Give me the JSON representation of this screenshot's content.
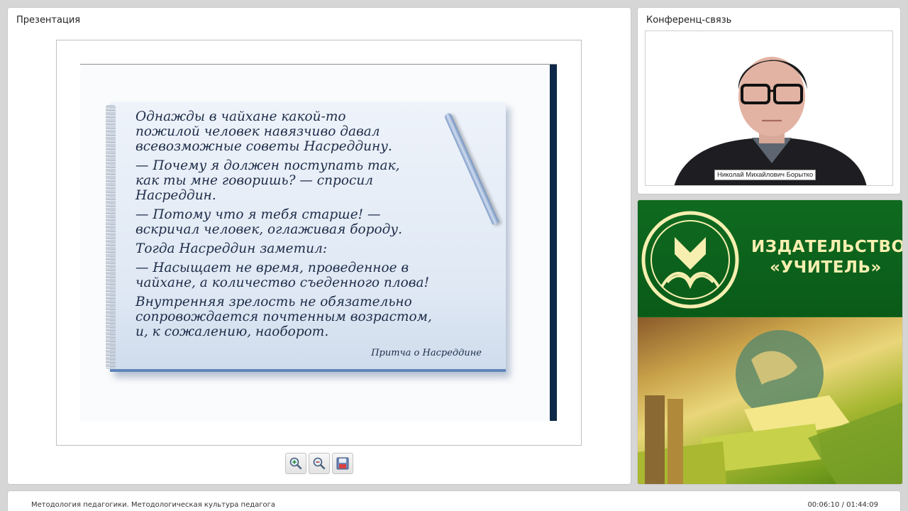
{
  "presentation": {
    "title": "Презентация",
    "slide": {
      "quote_lines": [
        "Однажды в чайхане какой-то",
        "пожилой человек навязчиво давал",
        "всевозможные советы Насреддину.",
        "— Почему я должен поступать так,",
        "как ты мне говоришь? — спросил",
        "Насреддин.",
        "— Потому что я тебя старше! —",
        "вскричал человек, оглаживая бороду.",
        "Тогда Насреддин заметил:",
        "— Насыщает не время, проведенное в",
        "чайхане, а количество съеденного плова!",
        "Внутренняя зрелость не обязательно",
        "сопровождается почтенным возрастом,",
        "и, к сожалению, наоборот."
      ],
      "source": "Притча о Насреддине"
    },
    "toolbar": {
      "zoom_in_icon": "zoom-in-icon",
      "zoom_out_icon": "zoom-out-icon",
      "save_icon": "save-icon"
    }
  },
  "conference": {
    "title": "Конференц-связь",
    "speaker_name": "Николай Михайлович Борытко"
  },
  "banner": {
    "line1": "ИЗДАТЕЛЬСТВО",
    "line2": "«УЧИТЕЛЬ»",
    "brand_color": "#0f6a1f",
    "text_color": "#f6efb0"
  },
  "footer": {
    "title": "Методология педагогики. Методологическая культура педагога",
    "time": "00:06:10 / 01:44:09"
  }
}
